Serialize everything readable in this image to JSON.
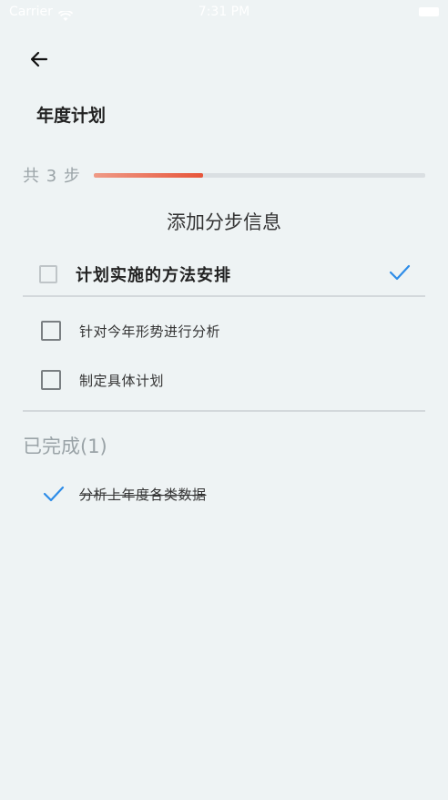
{
  "status_bar": {
    "carrier": "Carrier",
    "time": "7:31 PM"
  },
  "header": {
    "title": "年度计划"
  },
  "progress": {
    "label": "共 3 步",
    "total_steps": 3,
    "fraction": 0.33,
    "accent_color": "#e7553a"
  },
  "form": {
    "heading": "添加分步信息",
    "input_value": "计划实施的方法安排",
    "input_placeholder": "",
    "confirm_color": "#2d8ce8"
  },
  "todo_items": [
    {
      "label": "针对今年形势进行分析",
      "checked": false
    },
    {
      "label": "制定具体计划",
      "checked": false
    }
  ],
  "completed": {
    "heading": "已完成(1)",
    "items": [
      {
        "label": "分析上年度各类数据",
        "checked": true
      }
    ]
  },
  "icons": {
    "back": "arrow-left-icon",
    "confirm": "check-icon",
    "done": "check-icon",
    "wifi": "wifi-icon",
    "battery": "battery-icon"
  }
}
